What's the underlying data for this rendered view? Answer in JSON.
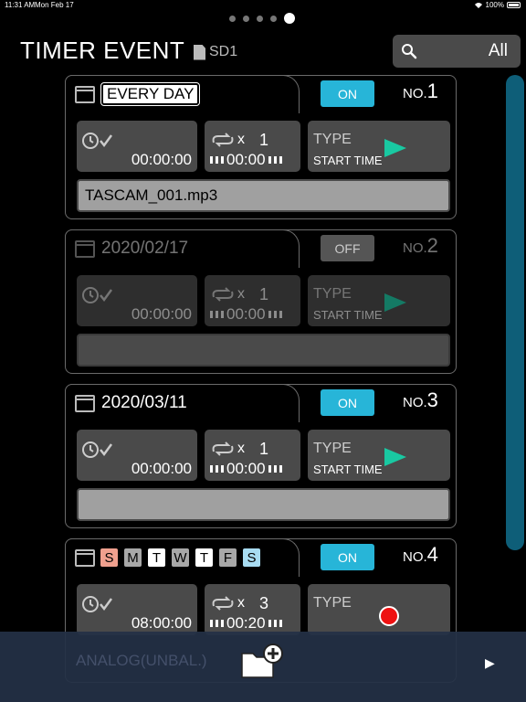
{
  "status_bar": {
    "time": "11:31 AM",
    "date": "Mon Feb 17",
    "battery": "100%"
  },
  "header": {
    "title": "TIMER EVENT",
    "storage": "SD1",
    "filter_label": "All",
    "page_dots": 5,
    "active_page": 5
  },
  "events": [
    {
      "header_text": "EVERY DAY",
      "switch": "ON",
      "no_prefix": "NO.",
      "no_num": "1",
      "start_time": "00:00:00",
      "repeat_prefix": "x",
      "repeat_count": "1",
      "duration": "00:00",
      "type_label": "TYPE",
      "type_value": "START TIME",
      "file": "TASCAM_001.mp3"
    },
    {
      "header_text": "2020/02/17",
      "switch": "OFF",
      "no_prefix": "NO.",
      "no_num": "2",
      "start_time": "00:00:00",
      "repeat_prefix": "x",
      "repeat_count": "1",
      "duration": "00:00",
      "type_label": "TYPE",
      "type_value": "START TIME",
      "file": ""
    },
    {
      "header_text": "2020/03/11",
      "switch": "ON",
      "no_prefix": "NO.",
      "no_num": "3",
      "start_time": "00:00:00",
      "repeat_prefix": "x",
      "repeat_count": "1",
      "duration": "00:00",
      "type_label": "TYPE",
      "type_value": "START TIME",
      "file": ""
    },
    {
      "days": [
        "S",
        "M",
        "T",
        "W",
        "T",
        "F",
        "S"
      ],
      "switch": "ON",
      "no_prefix": "NO.",
      "no_num": "4",
      "start_time": "08:00:00",
      "repeat_prefix": "x",
      "repeat_count": "3",
      "duration": "00:20",
      "type_label": "TYPE",
      "file": "ANALOG(UNBAL.)"
    }
  ],
  "colors": {
    "on": "#27b5d8",
    "play": "#19c9a2",
    "rec": "#e11111",
    "sunday": "#f0a08e",
    "saturday": "#a8dcf2"
  },
  "icons": {
    "search": "magnifier-icon",
    "calendar": "calendar-icon",
    "clock": "clock-check-icon",
    "repeat": "repeat-icon",
    "add_folder": "folder-plus-icon",
    "next": "play-triangle-icon"
  }
}
